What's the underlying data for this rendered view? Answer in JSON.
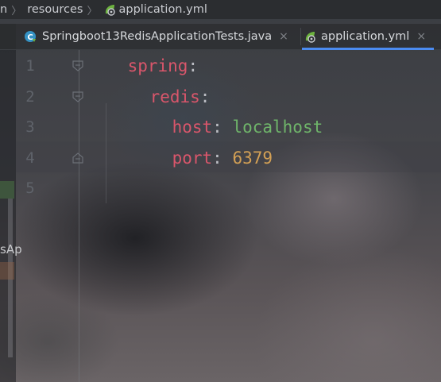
{
  "breadcrumb": {
    "partial": "n",
    "folder": "resources",
    "file": "application.yml"
  },
  "tabs": [
    {
      "label": "Springboot13RedisApplicationTests.java",
      "icon": "java-test-class-icon",
      "active": false
    },
    {
      "label": "application.yml",
      "icon": "spring-yml-icon",
      "active": true
    }
  ],
  "tab_close_glyph": "×",
  "side_panel_text": "sAp",
  "editor": {
    "lines": [
      {
        "number": "1",
        "key": "spring",
        "colon": ":",
        "value": ""
      },
      {
        "number": "2",
        "key": "redis",
        "colon": ":",
        "value": ""
      },
      {
        "number": "3",
        "key": "host",
        "colon": ": ",
        "value": "localhost"
      },
      {
        "number": "4",
        "key": "port",
        "colon": ": ",
        "value": "6379"
      },
      {
        "number": "5",
        "key": "",
        "colon": "",
        "value": ""
      }
    ]
  },
  "colors": {
    "key": "#d9566b",
    "string": "#6fb56a",
    "number": "#d3a055",
    "active_tab_underline": "#4b8bf0"
  }
}
